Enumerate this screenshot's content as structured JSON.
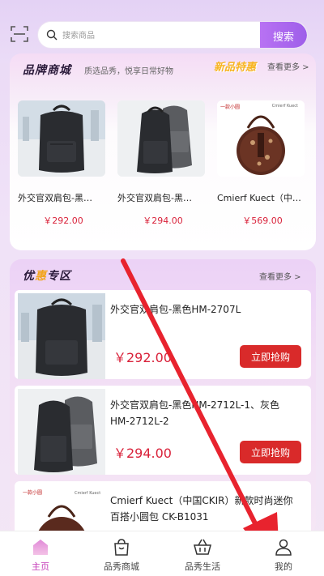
{
  "search": {
    "placeholder": "搜索商品",
    "button_label": "搜索"
  },
  "brand_mall": {
    "title_part1": "品牌",
    "title_part2": "商城",
    "slogan": "质选品秀，悦享日常好物",
    "new_label": "新品特惠",
    "more_label": "查看更多 >",
    "products": [
      {
        "name": "外交官双肩包-黑…",
        "price": "￥292.00"
      },
      {
        "name": "外交官双肩包-黑…",
        "price": "￥294.00"
      },
      {
        "name": "Cmierf Kuect（中…",
        "price": "￥569.00",
        "brand_tag": "Cmierf Kuect"
      }
    ]
  },
  "preferred_zone": {
    "title_part1": "优",
    "title_part2": "惠",
    "title_part3": "专区",
    "more_label": "查看更多 >",
    "items": [
      {
        "name": "外交官双肩包-黑色HM-2707L",
        "price": "￥292.00",
        "button": "立即抢购"
      },
      {
        "name": "外交官双肩包-黑色HM-2712L-1、灰色HM-2712L-2",
        "price": "￥294.00",
        "button": "立即抢购"
      },
      {
        "name": "Cmierf Kuect（中国CKIR）新款时尚迷你百搭小圆包 CK-B1031",
        "price": "",
        "button": ""
      }
    ]
  },
  "bottom_nav": {
    "items": [
      {
        "label": "主页",
        "icon": "home-icon",
        "active": true
      },
      {
        "label": "品秀商城",
        "icon": "shopping-bag-icon",
        "active": false
      },
      {
        "label": "品秀生活",
        "icon": "basket-icon",
        "active": false
      },
      {
        "label": "我的",
        "icon": "user-icon",
        "active": false
      }
    ]
  },
  "colors": {
    "accent_purple": "#a563ee",
    "price_red": "#d9223a",
    "buy_button": "#d92a2a",
    "arrow": "#e8232e",
    "nav_active": "#c43bb8"
  }
}
